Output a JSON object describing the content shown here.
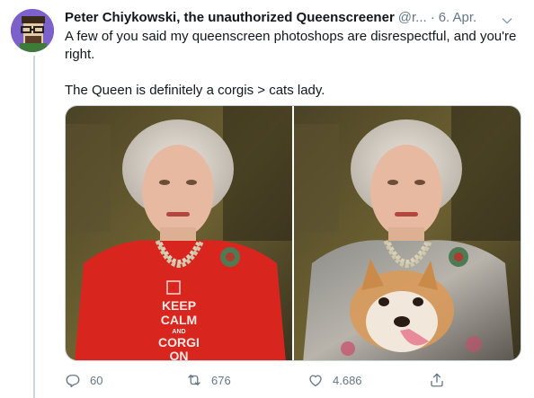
{
  "tweet": {
    "display_name": "Peter Chiykowski, the unauthorized Queenscreener",
    "handle": "@r...",
    "separator": "·",
    "date": "6. Apr.",
    "text_line1": "A few of you said my queenscreen photoshops are disrespectful, and you're right.",
    "text_line2": "The Queen is definitely a corgis > cats lady."
  },
  "media": {
    "left_sign": [
      "KEEP",
      "CALM",
      "AND",
      "CORGI",
      "ON"
    ]
  },
  "actions": {
    "replies": "60",
    "retweets": "676",
    "likes": "4.686"
  },
  "icons": {
    "reply": "reply-icon",
    "retweet": "retweet-icon",
    "like": "heart-icon",
    "share": "share-icon",
    "menu": "chevron-down-icon"
  },
  "colors": {
    "text": "#14171a",
    "secondary": "#657786",
    "divider": "#ccd6dd",
    "red_dress": "#d8261f"
  }
}
